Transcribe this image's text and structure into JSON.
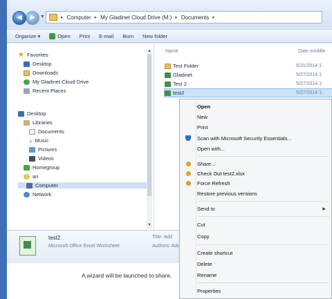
{
  "address": {
    "crumbs": [
      "Computer",
      "My Gladinet Cloud Drive (M:)",
      "Documents"
    ]
  },
  "toolbar": {
    "organize": "Organize ▾",
    "open": "Open",
    "print": "Print",
    "email": "E-mail",
    "burn": "Burn",
    "new_folder": "New folder"
  },
  "nav": {
    "favorites": "Favorites",
    "desktop_fav": "Desktop",
    "downloads": "Downloads",
    "gladinet": "My Gladinet Cloud Drive",
    "recent": "Recent Places",
    "desktop": "Desktop",
    "libraries": "Libraries",
    "documents": "Documents",
    "music": "Music",
    "pictures": "Pictures",
    "videos": "Videos",
    "homegroup": "Homegroup",
    "user": "an",
    "computer": "Computer",
    "network": "Network"
  },
  "columns": {
    "name": "Name",
    "date": "Date modifie"
  },
  "files": [
    {
      "name": "Test Folder",
      "date": "5/31/2014 1"
    },
    {
      "name": "Gladinet",
      "date": "5/27/2014 1:"
    },
    {
      "name": "Test 2",
      "date": "5/27/2014 1:"
    },
    {
      "name": "test2",
      "date": "5/27/2014 1:"
    }
  ],
  "details": {
    "name": "test2",
    "type": "Microsoft Office Excel Worksheet",
    "title_label": "Title: Add",
    "authors_label": "Authors: Add"
  },
  "doc_text": "A wizard will be launched to share.",
  "menu": {
    "open": "Open",
    "new": "New",
    "print": "Print",
    "scan": "Scan with Microsoft Security Essentials...",
    "open_with": "Open with...",
    "share": "Share...",
    "check_out": "Check Out test2.xlsx",
    "force_refresh": "Force Refresh",
    "restore": "Restore previous versions",
    "send_to": "Send to",
    "cut": "Cut",
    "copy": "Copy",
    "create_shortcut": "Create shortcut",
    "delete": "Delete",
    "rename": "Rename",
    "properties": "Properties"
  },
  "colors": {
    "accent": "#3f6fb6",
    "selection": "#cde3f7"
  }
}
